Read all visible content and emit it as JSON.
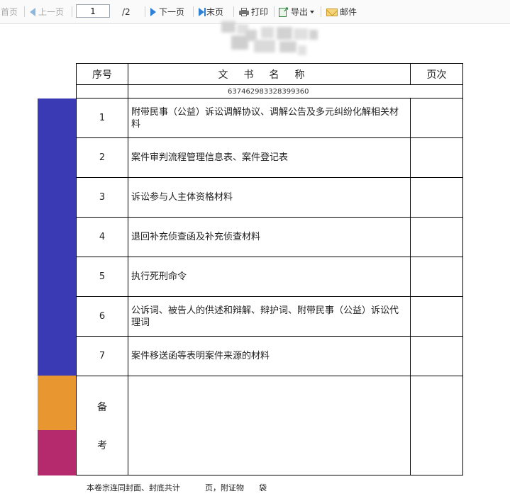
{
  "toolbar": {
    "first_page": "首页",
    "prev_page": "上一页",
    "current_page": "1",
    "total_pages": "/2",
    "next_page": "下一页",
    "last_page": "末页",
    "print": "打印",
    "export": "导出",
    "mail": "邮件"
  },
  "table": {
    "header": {
      "number": "序号",
      "name": "文书名称",
      "page": "页次"
    },
    "code": "637462983328399360",
    "rows": [
      {
        "number": "1",
        "name": "附带民事（公益）诉讼调解协议、调解公告及多元纠纷化解相关材料",
        "page": ""
      },
      {
        "number": "2",
        "name": "案件审判流程管理信息表、案件登记表",
        "page": ""
      },
      {
        "number": "3",
        "name": "诉讼参与人主体资格材料",
        "page": ""
      },
      {
        "number": "4",
        "name": "退回补充侦查函及补充侦查材料",
        "page": ""
      },
      {
        "number": "5",
        "name": "执行死刑命令",
        "page": ""
      },
      {
        "number": "6",
        "name": "公诉词、被告人的供述和辩解、辩护词、附带民事（公益）诉讼代理词",
        "page": ""
      },
      {
        "number": "7",
        "name": "案件移送函等表明案件来源的材料",
        "page": ""
      }
    ],
    "remarks": {
      "char1": "备",
      "char2": "考"
    }
  },
  "footer": {
    "note": "本卷宗连同封面、封底共计          页，附证物      袋"
  },
  "colors": {
    "sidebar_blue": "#3a3ab4",
    "sidebar_orange": "#e8962f",
    "sidebar_magenta": "#b52a6c",
    "toolbar_accent": "#2f7fd3"
  }
}
